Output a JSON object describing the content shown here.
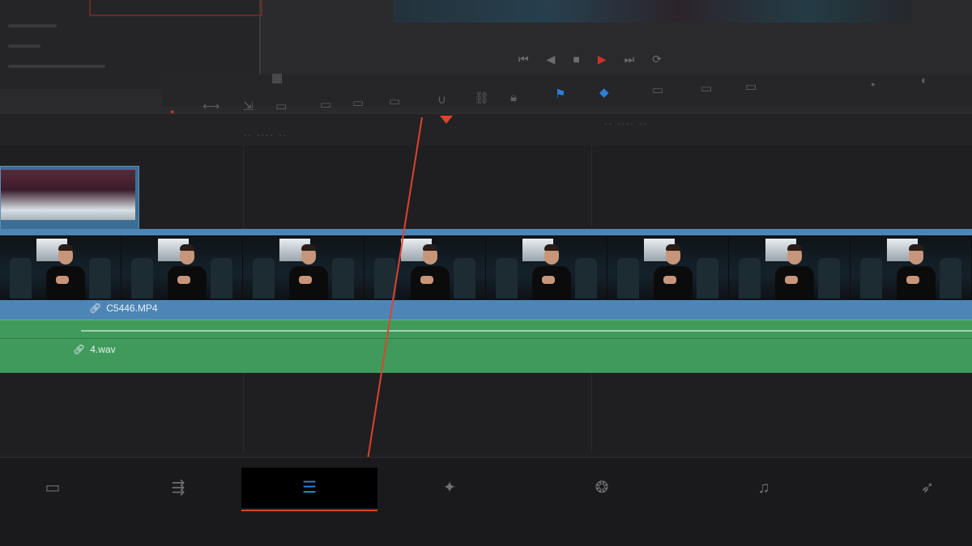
{
  "timeline": {
    "video_clip": {
      "name": "C5446.MP4",
      "link_icon": "link-icon"
    },
    "audio_clip": {
      "name": "4.wav",
      "link_icon": "link-icon"
    }
  },
  "colors": {
    "video_clip": "#4d86b6",
    "audio_clip": "#3f9a5c",
    "playhead": "#e0422f",
    "active_page_icon": "#2c7fd6"
  },
  "page_bar": {
    "pages": [
      {
        "name": "media",
        "icon": "media-icon",
        "glyph": "▭"
      },
      {
        "name": "cut",
        "icon": "cut-icon",
        "glyph": "⇶"
      },
      {
        "name": "edit",
        "icon": "edit-icon",
        "glyph": "☰",
        "active": true
      },
      {
        "name": "fusion",
        "icon": "fusion-icon",
        "glyph": "✦"
      },
      {
        "name": "color",
        "icon": "color-icon",
        "glyph": "❂"
      },
      {
        "name": "fairlight",
        "icon": "fairlight-icon",
        "glyph": "♫"
      },
      {
        "name": "deliver",
        "icon": "deliver-icon",
        "glyph": "➶"
      }
    ]
  },
  "transport": {
    "buttons": [
      {
        "name": "go-to-start-icon",
        "glyph": "⏮"
      },
      {
        "name": "reverse-icon",
        "glyph": "◀"
      },
      {
        "name": "stop-icon",
        "glyph": "■"
      },
      {
        "name": "play-icon",
        "glyph": "▶"
      },
      {
        "name": "go-to-end-icon",
        "glyph": "⏭"
      },
      {
        "name": "loop-icon",
        "glyph": "⟳"
      }
    ]
  }
}
